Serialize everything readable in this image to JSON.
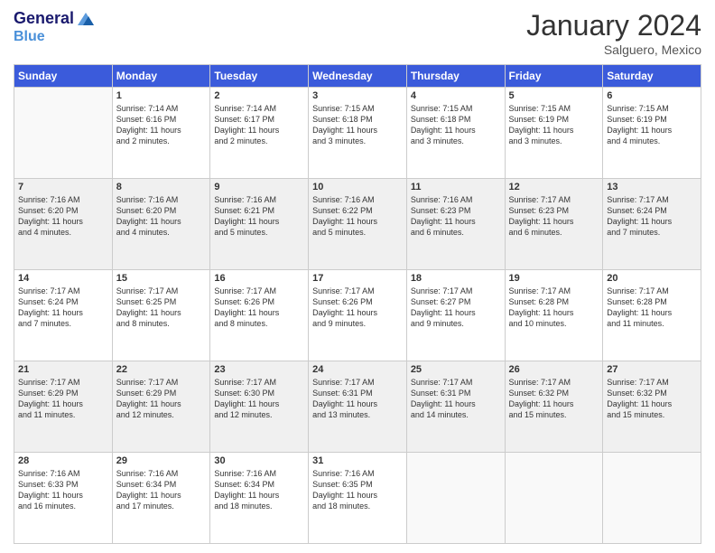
{
  "logo": {
    "line1": "General",
    "line2": "Blue"
  },
  "title": "January 2024",
  "subtitle": "Salguero, Mexico",
  "days_of_week": [
    "Sunday",
    "Monday",
    "Tuesday",
    "Wednesday",
    "Thursday",
    "Friday",
    "Saturday"
  ],
  "weeks": [
    [
      {
        "day": "",
        "info": ""
      },
      {
        "day": "1",
        "info": "Sunrise: 7:14 AM\nSunset: 6:16 PM\nDaylight: 11 hours\nand 2 minutes."
      },
      {
        "day": "2",
        "info": "Sunrise: 7:14 AM\nSunset: 6:17 PM\nDaylight: 11 hours\nand 2 minutes."
      },
      {
        "day": "3",
        "info": "Sunrise: 7:15 AM\nSunset: 6:18 PM\nDaylight: 11 hours\nand 3 minutes."
      },
      {
        "day": "4",
        "info": "Sunrise: 7:15 AM\nSunset: 6:18 PM\nDaylight: 11 hours\nand 3 minutes."
      },
      {
        "day": "5",
        "info": "Sunrise: 7:15 AM\nSunset: 6:19 PM\nDaylight: 11 hours\nand 3 minutes."
      },
      {
        "day": "6",
        "info": "Sunrise: 7:15 AM\nSunset: 6:19 PM\nDaylight: 11 hours\nand 4 minutes."
      }
    ],
    [
      {
        "day": "7",
        "info": "Sunrise: 7:16 AM\nSunset: 6:20 PM\nDaylight: 11 hours\nand 4 minutes."
      },
      {
        "day": "8",
        "info": "Sunrise: 7:16 AM\nSunset: 6:20 PM\nDaylight: 11 hours\nand 4 minutes."
      },
      {
        "day": "9",
        "info": "Sunrise: 7:16 AM\nSunset: 6:21 PM\nDaylight: 11 hours\nand 5 minutes."
      },
      {
        "day": "10",
        "info": "Sunrise: 7:16 AM\nSunset: 6:22 PM\nDaylight: 11 hours\nand 5 minutes."
      },
      {
        "day": "11",
        "info": "Sunrise: 7:16 AM\nSunset: 6:23 PM\nDaylight: 11 hours\nand 6 minutes."
      },
      {
        "day": "12",
        "info": "Sunrise: 7:17 AM\nSunset: 6:23 PM\nDaylight: 11 hours\nand 6 minutes."
      },
      {
        "day": "13",
        "info": "Sunrise: 7:17 AM\nSunset: 6:24 PM\nDaylight: 11 hours\nand 7 minutes."
      }
    ],
    [
      {
        "day": "14",
        "info": "Sunrise: 7:17 AM\nSunset: 6:24 PM\nDaylight: 11 hours\nand 7 minutes."
      },
      {
        "day": "15",
        "info": "Sunrise: 7:17 AM\nSunset: 6:25 PM\nDaylight: 11 hours\nand 8 minutes."
      },
      {
        "day": "16",
        "info": "Sunrise: 7:17 AM\nSunset: 6:26 PM\nDaylight: 11 hours\nand 8 minutes."
      },
      {
        "day": "17",
        "info": "Sunrise: 7:17 AM\nSunset: 6:26 PM\nDaylight: 11 hours\nand 9 minutes."
      },
      {
        "day": "18",
        "info": "Sunrise: 7:17 AM\nSunset: 6:27 PM\nDaylight: 11 hours\nand 9 minutes."
      },
      {
        "day": "19",
        "info": "Sunrise: 7:17 AM\nSunset: 6:28 PM\nDaylight: 11 hours\nand 10 minutes."
      },
      {
        "day": "20",
        "info": "Sunrise: 7:17 AM\nSunset: 6:28 PM\nDaylight: 11 hours\nand 11 minutes."
      }
    ],
    [
      {
        "day": "21",
        "info": "Sunrise: 7:17 AM\nSunset: 6:29 PM\nDaylight: 11 hours\nand 11 minutes."
      },
      {
        "day": "22",
        "info": "Sunrise: 7:17 AM\nSunset: 6:29 PM\nDaylight: 11 hours\nand 12 minutes."
      },
      {
        "day": "23",
        "info": "Sunrise: 7:17 AM\nSunset: 6:30 PM\nDaylight: 11 hours\nand 12 minutes."
      },
      {
        "day": "24",
        "info": "Sunrise: 7:17 AM\nSunset: 6:31 PM\nDaylight: 11 hours\nand 13 minutes."
      },
      {
        "day": "25",
        "info": "Sunrise: 7:17 AM\nSunset: 6:31 PM\nDaylight: 11 hours\nand 14 minutes."
      },
      {
        "day": "26",
        "info": "Sunrise: 7:17 AM\nSunset: 6:32 PM\nDaylight: 11 hours\nand 15 minutes."
      },
      {
        "day": "27",
        "info": "Sunrise: 7:17 AM\nSunset: 6:32 PM\nDaylight: 11 hours\nand 15 minutes."
      }
    ],
    [
      {
        "day": "28",
        "info": "Sunrise: 7:16 AM\nSunset: 6:33 PM\nDaylight: 11 hours\nand 16 minutes."
      },
      {
        "day": "29",
        "info": "Sunrise: 7:16 AM\nSunset: 6:34 PM\nDaylight: 11 hours\nand 17 minutes."
      },
      {
        "day": "30",
        "info": "Sunrise: 7:16 AM\nSunset: 6:34 PM\nDaylight: 11 hours\nand 18 minutes."
      },
      {
        "day": "31",
        "info": "Sunrise: 7:16 AM\nSunset: 6:35 PM\nDaylight: 11 hours\nand 18 minutes."
      },
      {
        "day": "",
        "info": ""
      },
      {
        "day": "",
        "info": ""
      },
      {
        "day": "",
        "info": ""
      }
    ]
  ]
}
